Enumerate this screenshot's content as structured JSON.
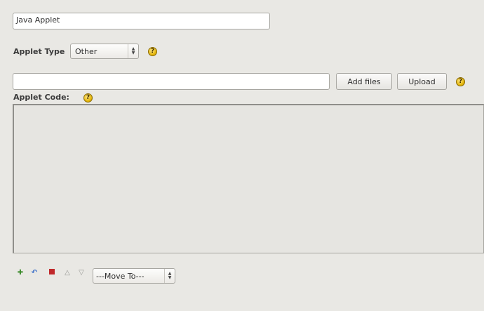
{
  "name_field": {
    "value": "Java Applet"
  },
  "applet_type": {
    "label": "Applet Type",
    "selected": "Other",
    "help_glyph": "?"
  },
  "upload_row": {
    "file_value": "",
    "add_files_label": "Add files",
    "upload_label": "Upload",
    "help_glyph": "?"
  },
  "applet_code": {
    "label": "Applet Code:",
    "help_glyph": "?",
    "value": ""
  },
  "toolbar": {
    "icons": [
      "add-icon",
      "undo-icon",
      "delete-icon",
      "move-up-icon",
      "move-down-icon"
    ],
    "move_to_selected": "---Move To---"
  },
  "colors": {
    "background": "#e9e8e4",
    "help_icon": "#e0b000",
    "delete_icon": "#c0282a",
    "add_icon": "#3a8a2a",
    "undo_icon": "#3a6ec8"
  }
}
